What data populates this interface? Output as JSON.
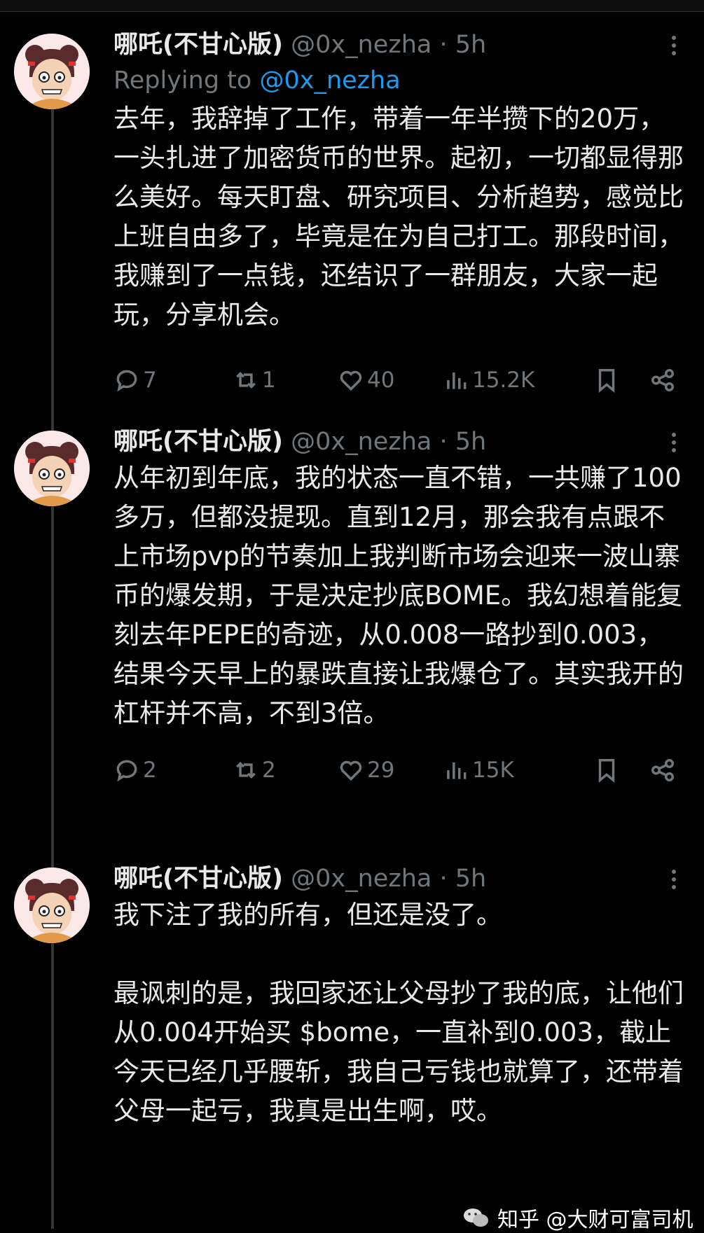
{
  "tweets": [
    {
      "author": "哪吒(不甘心版)",
      "handle": "@0x_nezha",
      "sep": "·",
      "time": "5h",
      "reply_prefix": "Replying to",
      "reply_to": "@0x_nezha",
      "text": "去年，我辞掉了工作，带着一年半攒下的20万，一头扎进了加密货币的世界。起初，一切都显得那么美好。每天盯盘、研究项目、分析趋势，感觉比上班自由多了，毕竟是在为自己打工。那段时间，我赚到了一点钱，还结识了一群朋友，大家一起玩，分享机会。",
      "replies": "7",
      "reposts": "1",
      "likes": "40",
      "views": "15.2K"
    },
    {
      "author": "哪吒(不甘心版)",
      "handle": "@0x_nezha",
      "sep": "·",
      "time": "5h",
      "text": "从年初到年底，我的状态一直不错，一共赚了100多万，但都没提现。直到12月，那会我有点跟不上市场pvp的节奏加上我判断市场会迎来一波山寨币的爆发期，于是决定抄底BOME。我幻想着能复刻去年PEPE的奇迹，从0.008一路抄到0.003，结果今天早上的暴跌直接让我爆仓了。其实我开的杠杆并不高，不到3倍。",
      "replies": "2",
      "reposts": "2",
      "likes": "29",
      "views": "15K"
    },
    {
      "author": "哪吒(不甘心版)",
      "handle": "@0x_nezha",
      "sep": "·",
      "time": "5h",
      "text": "我下注了我的所有，但还是没了。\n\n最讽刺的是，我回家还让父母抄了我的底，让他们从0.004开始买 $bome，一直补到0.003，截止今天已经几乎腰斩，我自己亏钱也就算了，还带着父母一起亏，我真是出生啊，哎。"
    }
  ],
  "watermark": {
    "text": "知乎 @大财可富司机",
    "icon": "wechat-icon"
  },
  "colors": {
    "background": "#000000",
    "text": "#e7e9ea",
    "muted": "#71767b",
    "link": "#1d9bf0"
  }
}
